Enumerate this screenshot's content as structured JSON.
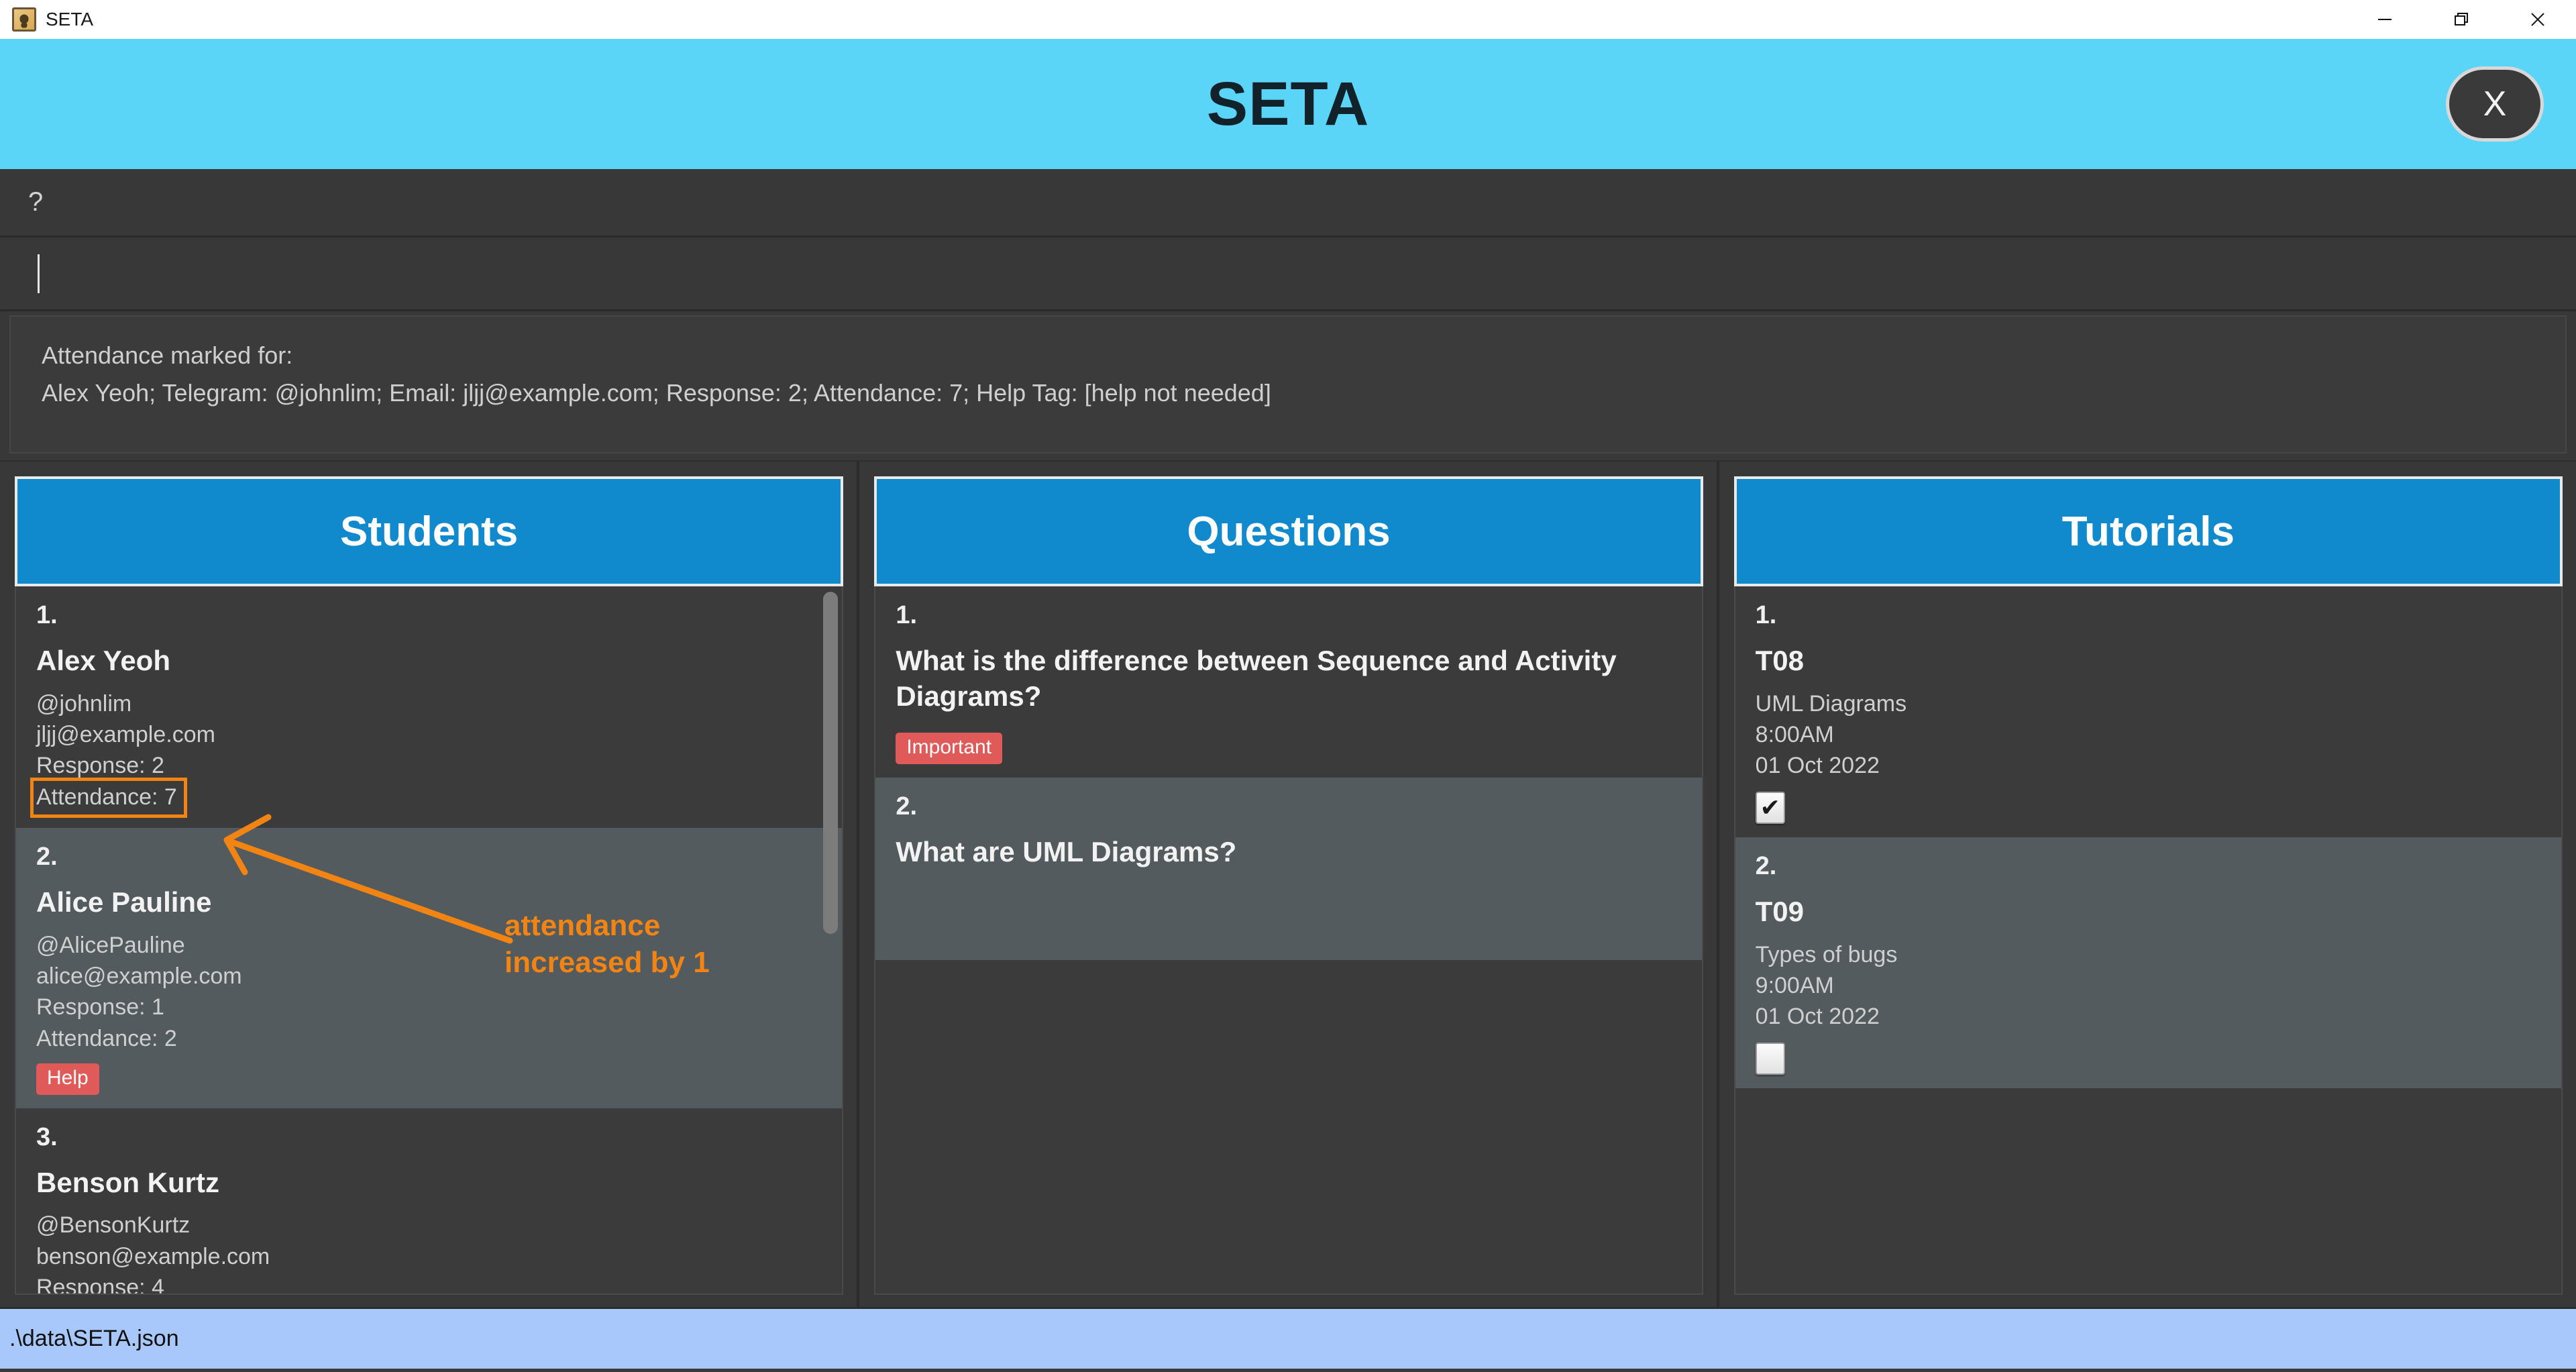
{
  "window": {
    "title": "SETA",
    "app_icon": "address-book-icon",
    "controls": {
      "minimize": "—",
      "maximize": "❐",
      "close": "✕"
    }
  },
  "banner": {
    "title": "SETA",
    "close_label": "X",
    "background": "#5ad4f7"
  },
  "help": {
    "label": "?"
  },
  "command": {
    "value": "",
    "placeholder": ""
  },
  "result": {
    "line1": "Attendance marked for:",
    "line2": "Alex Yeoh; Telegram: @johnlim; Email: jljj@example.com; Response: 2; Attendance: 7; Help Tag: [help not needed]"
  },
  "panels": {
    "students": {
      "title": "Students",
      "items": [
        {
          "index": "1.",
          "name": "Alex Yeoh",
          "telegram": "@johnlim",
          "email": "jljj@example.com",
          "response": "Response: 2",
          "attendance": "Attendance: 7",
          "tag": "",
          "highlighted": true
        },
        {
          "index": "2.",
          "name": "Alice Pauline",
          "telegram": "@AlicePauline",
          "email": "alice@example.com",
          "response": "Response: 1",
          "attendance": "Attendance: 2",
          "tag": "Help",
          "highlighted": false
        },
        {
          "index": "3.",
          "name": "Benson Kurtz",
          "telegram": "@BensonKurtz",
          "email": "benson@example.com",
          "response": "Response: 4",
          "attendance": "",
          "tag": "",
          "highlighted": false
        }
      ]
    },
    "questions": {
      "title": "Questions",
      "items": [
        {
          "index": "1.",
          "text": "What is the difference between Sequence and Activity Diagrams?",
          "tag": "Important"
        },
        {
          "index": "2.",
          "text": "What are UML Diagrams?",
          "tag": ""
        }
      ]
    },
    "tutorials": {
      "title": "Tutorials",
      "items": [
        {
          "index": "1.",
          "code": "T08",
          "topic": "UML Diagrams",
          "time": "8:00AM",
          "date": "01 Oct 2022",
          "checked": true,
          "check_glyph": "✔"
        },
        {
          "index": "2.",
          "code": "T09",
          "topic": "Types of bugs",
          "time": "9:00AM",
          "date": "01 Oct 2022",
          "checked": false,
          "check_glyph": ""
        }
      ]
    }
  },
  "annotation": {
    "text": "attendance\nincreased by 1",
    "color": "#f28413"
  },
  "statusbar": {
    "path": ".\\data\\SETA.json"
  },
  "colors": {
    "accent_blue": "#1089cd",
    "banner_blue": "#5ad4f7",
    "tag_red": "#e15a5a",
    "annotation_orange": "#f28413",
    "status_blue": "#a8c7fa",
    "panel_bg": "#3b3b3b",
    "alt_row": "#545b5e"
  }
}
